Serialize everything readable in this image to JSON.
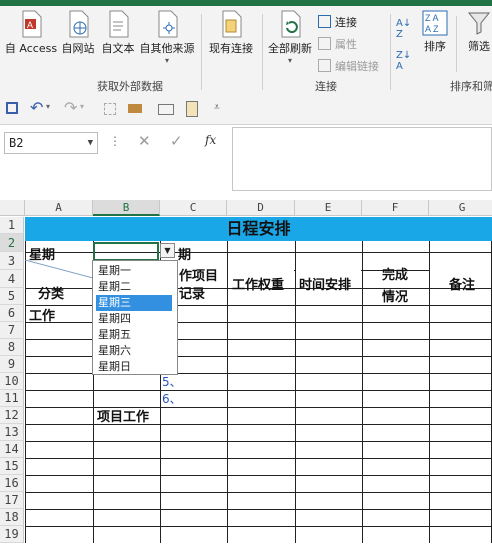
{
  "ribbon": {
    "group_external": {
      "label": "获取外部数据",
      "buttons": [
        {
          "label": "自 Access"
        },
        {
          "label": "自网站"
        },
        {
          "label": "自文本"
        },
        {
          "label": "自其他来源"
        },
        {
          "label": "现有连接"
        }
      ]
    },
    "group_connections": {
      "label": "连接",
      "refresh_all": "全部刷新",
      "connections": "连接",
      "properties": "属性",
      "edit_links": "编辑链接"
    },
    "group_sort": {
      "label": "排序和筛",
      "sort": "排序",
      "filter": "筛选"
    },
    "accent_color": "#217346"
  },
  "formula_bar": {
    "name_box": "B2",
    "fx": "fx",
    "formula": ""
  },
  "sheet": {
    "columns": [
      "A",
      "B",
      "C",
      "D",
      "E",
      "F",
      "G"
    ],
    "selected_column": "B",
    "rows": [
      "1",
      "2",
      "3",
      "4",
      "5",
      "6",
      "7",
      "8",
      "9",
      "10",
      "11",
      "12",
      "13",
      "14",
      "15",
      "16",
      "17",
      "18",
      "19"
    ],
    "selected_row": "2",
    "title": "日程安排",
    "title_color": "#1aa7e8",
    "cells": {
      "a2": "星期",
      "c2_tail": "期",
      "c3": "作项目",
      "c4": "记录",
      "d3": "工作权重",
      "e3": "时间安排",
      "f3": "完成",
      "f4": "情况",
      "g3": "备注",
      "a4": "分类",
      "a5": "工作",
      "c9": "5、",
      "c10": "6、",
      "b11": "项目工作"
    }
  },
  "dropdown": {
    "options": [
      "星期一",
      "星期二",
      "星期三",
      "星期四",
      "星期五",
      "星期六",
      "星期日"
    ],
    "selected_index": 2
  }
}
